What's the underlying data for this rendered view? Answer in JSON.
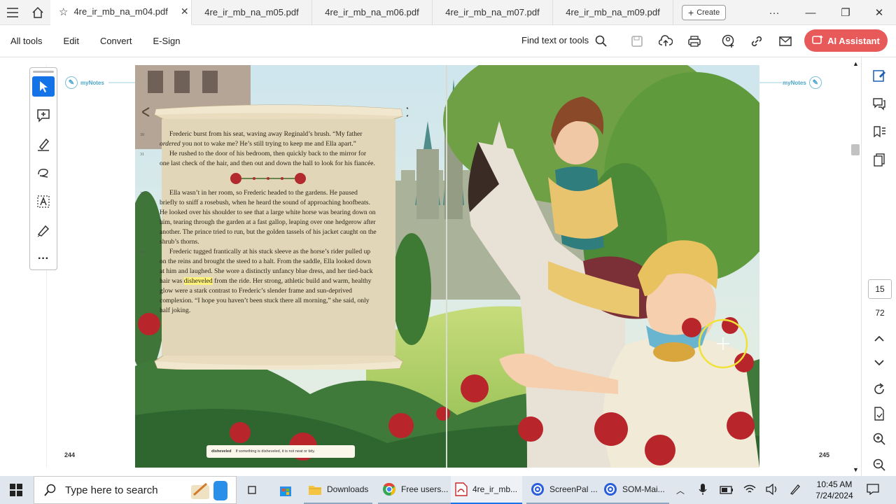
{
  "tabs": [
    {
      "label": "4re_ir_mb_na_m04.pdf",
      "active": true
    },
    {
      "label": "4re_ir_mb_na_m05.pdf"
    },
    {
      "label": "4re_ir_mb_na_m06.pdf"
    },
    {
      "label": "4re_ir_mb_na_m07.pdf"
    },
    {
      "label": "4re_ir_mb_na_m09.pdf"
    }
  ],
  "create_label": "Create",
  "menu": [
    "All tools",
    "Edit",
    "Convert",
    "E-Sign"
  ],
  "find_label": "Find text or tools",
  "ai_label": "AI Assistant",
  "mynotes": "myNotes",
  "page_left": "244",
  "page_right": "245",
  "story": {
    "p1_num": "30",
    "p1a": "Frederic burst from his seat, waving away Reginald’s brush. “My father ",
    "p1_em": "ordered",
    "p1b": " you not to wake me? He’s still trying to keep me and Ella apart.”",
    "p2_num": "31",
    "p2": "He rushed to the door of his bedroom, then quickly back to the mirror for one last check of the hair, and then out and down the hall to look for his fiancée.",
    "p3_num": "32",
    "p3": "Ella wasn’t in her room, so Frederic headed to the gardens. He paused briefly to sniff a rosebush, when he heard the sound of approaching hoofbeats. He looked over his shoulder to see that a large white horse was bearing down on him, tearing through the garden at a fast gallop, leaping over one hedgerow after another. The prince tried to run, but the golden tassels of his jacket caught on the shrub’s thorns.",
    "p4_num": "33",
    "p4a": "Frederic tugged frantically at his stuck sleeve as the horse’s rider pulled up on the reins and brought the steed to a halt. From the saddle, Ella looked down at him and laughed. She wore a distinctly unfancy blue dress, and her tied-back hair was ",
    "p4_hl": "disheveled",
    "p4b": " from the ride. Her strong, athletic build and warm, healthy glow were a stark contrast to Frederic’s slender frame and sun-deprived complexion. “I hope you haven’t been stuck there all morning,” she said, only half joking."
  },
  "gloss_word": "disheveled",
  "gloss_def": "If something is disheveled, it is not neat or tidy.",
  "current_page": "15",
  "total_pages": "72",
  "taskbar": {
    "search_placeholder": "Type here to search",
    "apps": [
      "Downloads",
      "Free users...",
      "4re_ir_mb...",
      "ScreenPal ...",
      "SOM-Mai..."
    ],
    "time": "10:45 AM",
    "date": "7/24/2024"
  },
  "colors": {
    "accent": "#1473e6",
    "ai_button": "#e8595a",
    "highlight": "#fff27a"
  }
}
